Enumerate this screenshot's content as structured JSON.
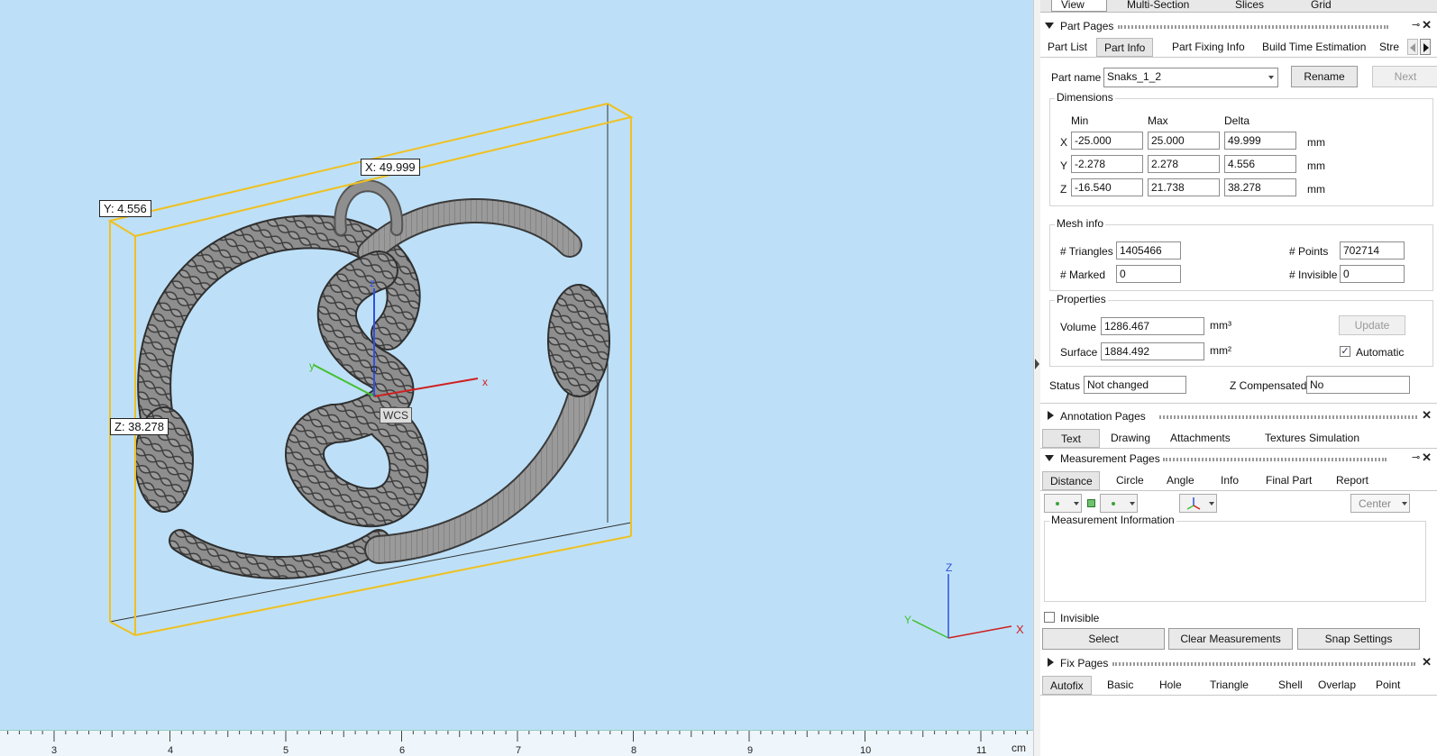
{
  "viewport": {
    "dim_x": "X: 49.999",
    "dim_y": "Y: 4.556",
    "dim_z": "Z: 38.278",
    "wcs": "WCS",
    "axis_x": "x",
    "axis_y": "y",
    "axis_z": "z",
    "triad_x": "X",
    "triad_y": "Y",
    "triad_z": "Z",
    "ruler_labels": [
      "3",
      "4",
      "5",
      "6",
      "7",
      "8",
      "9",
      "10",
      "11"
    ],
    "ruler_unit": "cm",
    "background_color": "#bde0f8",
    "bbox_color": "#f0c020"
  },
  "top_tabs": [
    "View",
    "Multi-Section",
    "Slices",
    "Grid"
  ],
  "part_pages": {
    "title": "Part Pages",
    "tabs": [
      "Part List",
      "Part Info",
      "Part Fixing Info",
      "Build Time Estimation",
      "Stre"
    ],
    "part_name_label": "Part name",
    "part_name_value": "Snaks_1_2",
    "rename": "Rename",
    "next": "Next",
    "dimensions": {
      "title": "Dimensions",
      "headers": [
        "Min",
        "Max",
        "Delta"
      ],
      "rows": [
        {
          "axis": "X",
          "min": "-25.000",
          "max": "25.000",
          "delta": "49.999",
          "unit": "mm"
        },
        {
          "axis": "Y",
          "min": "-2.278",
          "max": "2.278",
          "delta": "4.556",
          "unit": "mm"
        },
        {
          "axis": "Z",
          "min": "-16.540",
          "max": "21.738",
          "delta": "38.278",
          "unit": "mm"
        }
      ]
    },
    "mesh_info": {
      "title": "Mesh info",
      "triangles_label": "# Triangles",
      "triangles": "1405466",
      "points_label": "# Points",
      "points": "702714",
      "marked_label": "# Marked",
      "marked": "0",
      "invisible_label": "# Invisible",
      "invisible": "0"
    },
    "properties": {
      "title": "Properties",
      "volume_label": "Volume",
      "volume": "1286.467",
      "volume_unit": "mm³",
      "surface_label": "Surface",
      "surface": "1884.492",
      "surface_unit": "mm²",
      "update": "Update",
      "automatic": "Automatic"
    },
    "status_label": "Status",
    "status": "Not changed",
    "zcomp_label": "Z Compensated",
    "zcomp": "No"
  },
  "annotation_pages": {
    "title": "Annotation Pages",
    "tabs": [
      "Text",
      "Drawing",
      "Attachments",
      "Textures",
      "Simulation"
    ]
  },
  "measurement_pages": {
    "title": "Measurement Pages",
    "tabs": [
      "Distance",
      "Circle",
      "Angle",
      "Info",
      "Final Part",
      "Report"
    ],
    "center": "Center",
    "info_title": "Measurement Information",
    "invisible": "Invisible",
    "select": "Select",
    "clear": "Clear Measurements",
    "snap": "Snap Settings"
  },
  "fix_pages": {
    "title": "Fix Pages",
    "tabs": [
      "Autofix",
      "Basic",
      "Hole",
      "Triangle",
      "Shell",
      "Overlap",
      "Point"
    ]
  }
}
